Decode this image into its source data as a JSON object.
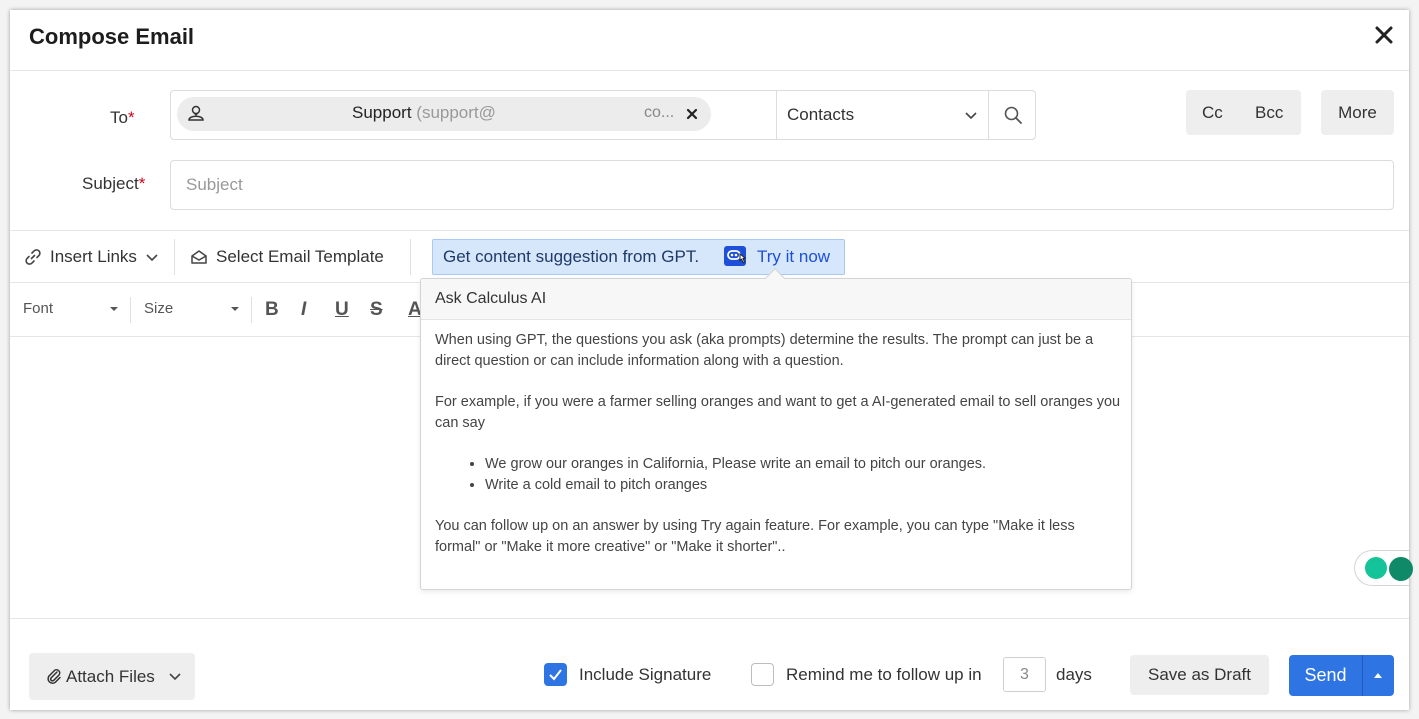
{
  "header": {
    "title": "Compose Email"
  },
  "to": {
    "label": "To",
    "required_mark": "*",
    "recipient_name": "Support",
    "recipient_email": "(support@",
    "recipient_ellipsis": "co...",
    "contacts_select": "Contacts"
  },
  "buttons": {
    "cc": "Cc",
    "bcc": "Bcc",
    "more": "More"
  },
  "subject": {
    "label": "Subject",
    "required_mark": "*",
    "placeholder": "Subject"
  },
  "toolbar": {
    "insert_links": "Insert Links",
    "select_template": "Select Email Template",
    "gpt_text": "Get content suggestion from GPT.",
    "gpt_link": "Try it now"
  },
  "format_bar": {
    "font": "Font",
    "size": "Size",
    "bold": "B",
    "italic": "I",
    "underline": "U",
    "strike": "S",
    "color": "A"
  },
  "popover": {
    "title": "Ask Calculus AI",
    "p1": "When using GPT, the questions you ask (aka prompts) determine the results. The prompt can just be a direct question or can include information along with a question.",
    "p2": "For example, if you were a farmer selling oranges and want to get a AI-generated email to sell oranges you can say",
    "bullets": [
      "We grow our oranges in California, Please write an email to pitch our oranges.",
      "Write a cold email to pitch oranges"
    ],
    "p3": "You can follow up on an answer by using Try again feature. For example, you can type \"Make it less formal\" or \"Make it more creative\" or \"Make it shorter\".."
  },
  "footer": {
    "attach_files": "Attach Files",
    "include_signature": "Include Signature",
    "include_signature_checked": true,
    "remind_label": "Remind me to follow up in",
    "remind_checked": false,
    "remind_days": "3",
    "days_label": "days",
    "save_draft": "Save as Draft",
    "send": "Send"
  },
  "colors": {
    "primary": "#2f74e3",
    "gpt_bg": "#d6e6fb",
    "required": "#d0021b"
  }
}
